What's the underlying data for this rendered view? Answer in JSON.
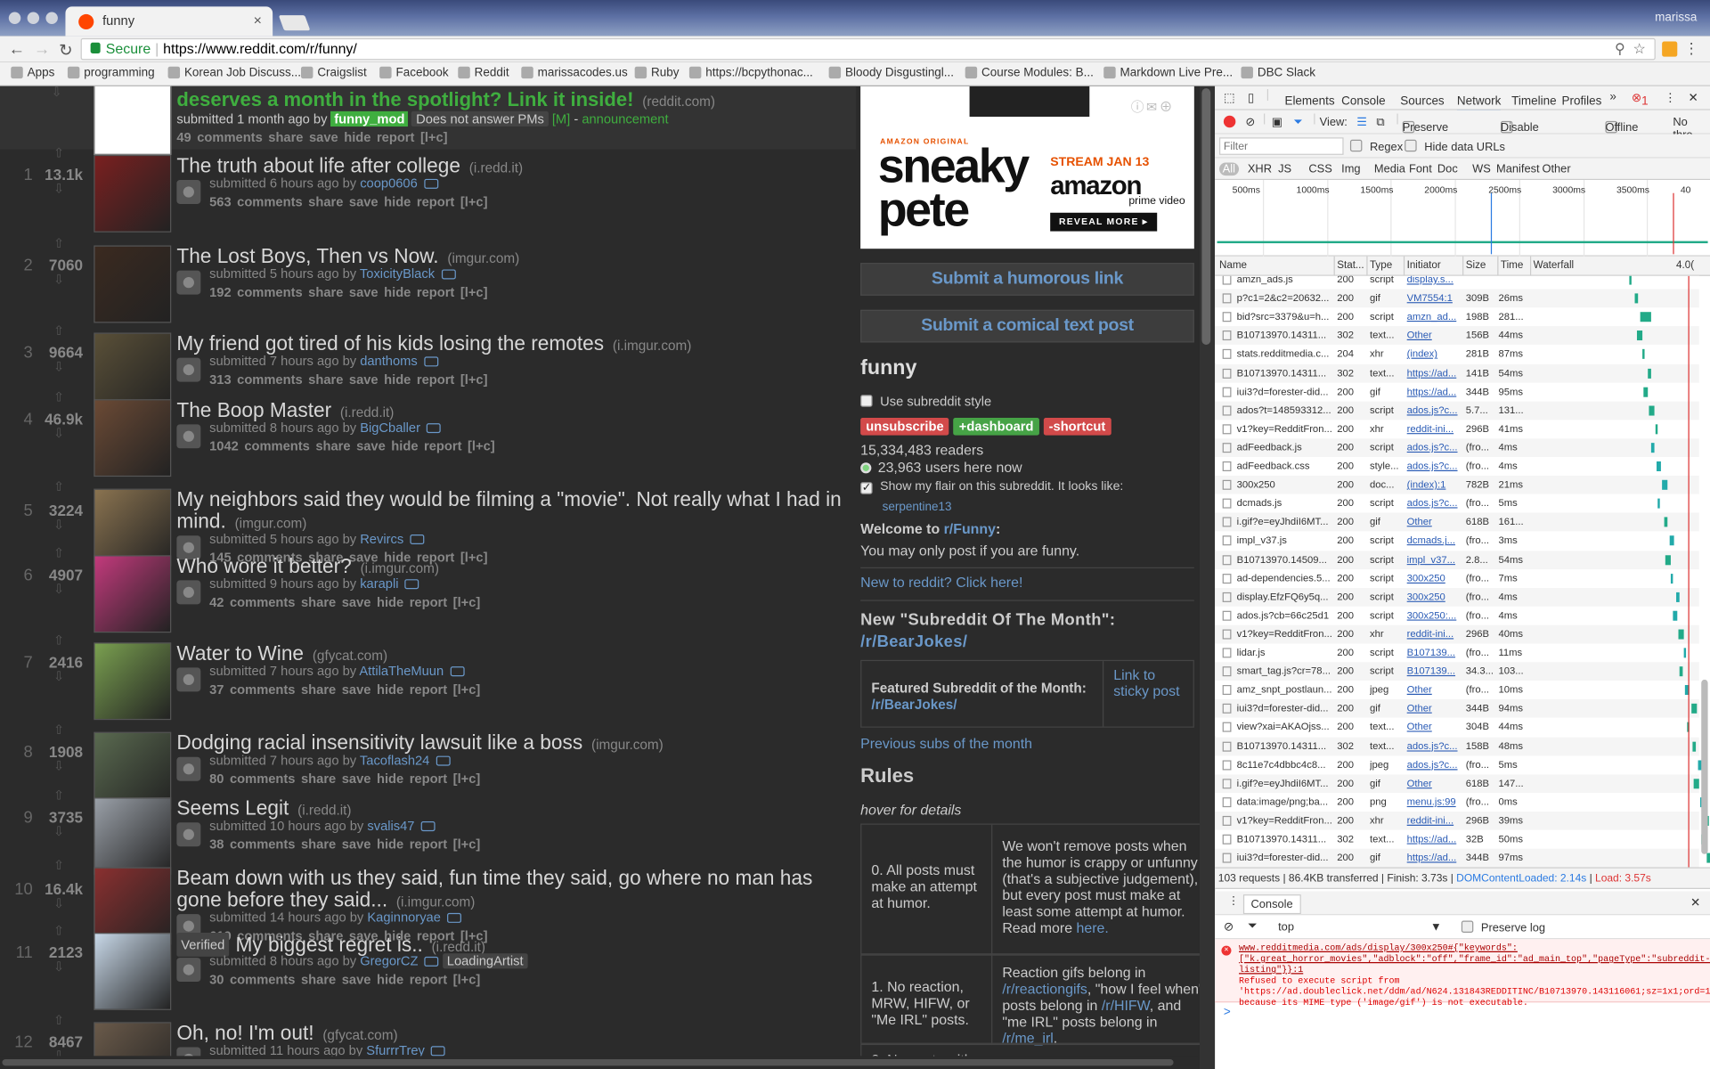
{
  "browser": {
    "tab_title": "funny",
    "url_secure": "Secure",
    "url": "https://www.reddit.com/r/funny/",
    "profile_name": "marissa",
    "bookmarks": [
      "Apps",
      "programming",
      "Korean Job Discuss...",
      "Craigslist",
      "Facebook",
      "Reddit",
      "marissacodes.us",
      "Ruby",
      "https://bcpythonac...",
      "Bloody Disgustingl...",
      "Course Modules: B...",
      "Markdown Live Pre...",
      "DBC Slack"
    ]
  },
  "sticky": {
    "title": "deserves a month in the spotlight? Link it inside!",
    "domain": "(reddit.com)",
    "submitted": "submitted 1 month ago by",
    "author": "funny_mod",
    "flair": "Does not answer PMs",
    "mod": "[M]",
    "dash": "-",
    "announcement": "announcement",
    "actions": "49 comments   share   save   hide   report   [l+c]"
  },
  "posts": [
    {
      "rank": "1",
      "score": "13.1k",
      "title": "The truth about life after college",
      "domain": "(i.redd.it)",
      "submitted": "submitted 6 hours ago by",
      "author": "coop0606",
      "actions": "563 comments   share   save   hide   report   [l+c]",
      "thumb": "#7a2020"
    },
    {
      "rank": "2",
      "score": "7060",
      "title": "The Lost Boys, Then vs Now.",
      "domain": "(imgur.com)",
      "submitted": "submitted 5 hours ago by",
      "author": "ToxicityBlack",
      "actions": "192 comments   share   save   hide   report   [l+c]",
      "thumb": "#3b2a20"
    },
    {
      "rank": "3",
      "score": "9664",
      "title": "My friend got tired of his kids losing the remotes",
      "domain": "(i.imgur.com)",
      "submitted": "submitted 7 hours ago by",
      "author": "danthoms",
      "actions": "313 comments   share   save   hide   report   [l+c]",
      "thumb": "#5a5038"
    },
    {
      "rank": "4",
      "score": "46.9k",
      "title": "The Boop Master",
      "domain": "(i.redd.it)",
      "submitted": "submitted 8 hours ago by",
      "author": "BigCballer",
      "actions": "1042 comments   share   save   hide   report   [l+c]",
      "thumb": "#6b4a35"
    },
    {
      "rank": "5",
      "score": "3224",
      "title": "My neighbors said they would be filming a \"movie\". Not really what I had in mind.",
      "domain": "(imgur.com)",
      "submitted": "submitted 5 hours ago by",
      "author": "Revircs",
      "actions": "145 comments   share   save   hide   report   [l+c]",
      "thumb": "#8a7350"
    },
    {
      "rank": "6",
      "score": "4907",
      "title": "Who wore it better?",
      "domain": "(i.imgur.com)",
      "submitted": "submitted 9 hours ago by",
      "author": "karapli",
      "actions": "42 comments   share   save   hide   report   [l+c]",
      "thumb": "#c23a7c"
    },
    {
      "rank": "7",
      "score": "2416",
      "title": "Water to Wine",
      "domain": "(gfycat.com)",
      "submitted": "submitted 7 hours ago by",
      "author": "AttilaTheMuun",
      "actions": "37 comments   share   save   hide   report   [l+c]",
      "thumb": "#7aa050"
    },
    {
      "rank": "8",
      "score": "1908",
      "title": "Dodging racial insensitivity lawsuit like a boss",
      "domain": "(imgur.com)",
      "submitted": "submitted 7 hours ago by",
      "author": "Tacoflash24",
      "actions": "80 comments   share   save   hide   report   [l+c]",
      "thumb": "#5a6a50"
    },
    {
      "rank": "9",
      "score": "3735",
      "title": "Seems Legit",
      "domain": "(i.redd.it)",
      "submitted": "submitted 10 hours ago by",
      "author": "svalis47",
      "actions": "38 comments   share   save   hide   report   [l+c]",
      "thumb": "#9aa0a8"
    },
    {
      "rank": "10",
      "score": "16.4k",
      "title": "Beam down with us they said, fun time they said, go where no man has gone before they said...",
      "domain": "(i.imgur.com)",
      "submitted": "submitted 14 hours ago by",
      "author": "Kaginnoryae",
      "actions": "619 comments   share   save   hide   report   [l+c]",
      "thumb": "#8a3030"
    },
    {
      "rank": "11",
      "score": "2123",
      "title": "My biggest regret is..",
      "domain": "(i.redd.it)",
      "submitted": "submitted 8 hours ago by",
      "author": "GregorCZ",
      "flair": "LoadingArtist",
      "verified": "Verified",
      "actions": "30 comments   share   save   hide   report   [l+c]",
      "thumb": "#c8d8e8"
    },
    {
      "rank": "12",
      "score": "8467",
      "title": "Oh, no! I'm out!",
      "domain": "(gfycat.com)",
      "submitted": "submitted 11 hours ago by",
      "author": "SfurrrTrey",
      "actions": "",
      "thumb": "#6a5a4a"
    }
  ],
  "sidebar": {
    "ad": {
      "label": "AMAZON ORIGINAL",
      "show1": "sneaky",
      "show2": "pete",
      "stream": "STREAM JAN 13",
      "brand": "amazon",
      "sub": "prime video",
      "cta": "REVEAL MORE ▸"
    },
    "submit_link": "Submit a humorous link",
    "submit_text": "Submit a comical text post",
    "name": "funny",
    "use_style": "Use subreddit style",
    "unsubscribe": "unsubscribe",
    "dashboard": "+dashboard",
    "shortcut": "-shortcut",
    "readers": "15,334,483 readers",
    "online": "23,963 users here now",
    "flair_text": "Show my flair on this subreddit. It looks like:",
    "flair_user": "serpentine13",
    "welcome1": "Welcome to ",
    "welcome_link": "r/Funny",
    "welcome2": ":",
    "only_funny": "You may only post if you are funny.",
    "new_to": "New to reddit? Click here!",
    "sotm1": "New \"Subreddit Of The Month\":",
    "sotm2": "/r/BearJokes/",
    "feat1": "Featured Subreddit of the Month:",
    "feat2": "/r/BearJokes/",
    "feat_link": "Link to sticky post",
    "prev": "Previous subs of the month",
    "rules": "Rules",
    "hover": "hover for details",
    "rule0": "0. All posts must make an attempt at humor.",
    "rule0_desc": "We won't remove posts when the humor is crappy or unfunny (that's a subjective judgement), but every post must make at least some attempt at humor. Read more",
    "rule0_here": "here.",
    "rule1": "1. No reaction, MRW, HIFW, or \"Me IRL\" posts.",
    "rule1_a": "Reaction gifs belong in",
    "rule1_b": "/r/reactiongifs",
    "rule1_c": ", \"how I feel when\" posts belong in",
    "rule1_d": "/r/HIFW",
    "rule1_e": ", and \"me IRL\" posts belong in",
    "rule1_f": "/r/me_irl",
    "rule1_g": ".",
    "rule2": "2. No posts with..."
  },
  "devtools": {
    "tabs": [
      "Elements",
      "Console",
      "Sources",
      "Network",
      "Timeline",
      "Profiles"
    ],
    "error_count": "1",
    "view": "View:",
    "preserve": "Preserve log",
    "disable": "Disable cache",
    "offline": "Offline",
    "nothrot": "No thro",
    "filter_ph": "Filter",
    "regex": "Regex",
    "hide_urls": "Hide data URLs",
    "types": [
      "All",
      "XHR",
      "JS",
      "CSS",
      "Img",
      "Media",
      "Font",
      "Doc",
      "WS",
      "Manifest",
      "Other"
    ],
    "ticks": [
      "500ms",
      "1000ms",
      "1500ms",
      "2000ms",
      "2500ms",
      "3000ms",
      "3500ms",
      "40"
    ],
    "cols": [
      "Name",
      "Stat...",
      "Type",
      "Initiator",
      "Size",
      "Time",
      "Waterfall",
      "4.0("
    ],
    "rows": [
      [
        "amzn_ads.js",
        "200",
        "script",
        "display.s...",
        "",
        "",
        "#2a8"
      ],
      [
        "p?c1=2&c2=20632...",
        "200",
        "gif",
        "VM7554:1",
        "309B",
        "26ms",
        "#2a8"
      ],
      [
        "bid?src=3379&u=h...",
        "200",
        "script",
        "amzn_ad...",
        "198B",
        "281...",
        "#2a8"
      ],
      [
        "B10713970.14311...",
        "302",
        "text...",
        "Other",
        "156B",
        "44ms",
        "#2a8"
      ],
      [
        "stats.redditmedia.c...",
        "204",
        "xhr",
        "(index)",
        "281B",
        "87ms",
        "#2a8"
      ],
      [
        "B10713970.14311...",
        "302",
        "text...",
        "https://ad...",
        "141B",
        "54ms",
        "#2a8"
      ],
      [
        "iui3?d=forester-did...",
        "200",
        "gif",
        "https://ad...",
        "344B",
        "95ms",
        "#2a8"
      ],
      [
        "ados?t=148593312...",
        "200",
        "script",
        "ados.js?c...",
        "5.7...",
        "131...",
        "#2a8"
      ],
      [
        "v1?key=RedditFron...",
        "200",
        "xhr",
        "reddit-ini...",
        "296B",
        "41ms",
        "#2a8"
      ],
      [
        "adFeedback.js",
        "200",
        "script",
        "ados.js?c...",
        "(fro...",
        "4ms",
        "#2aa"
      ],
      [
        "adFeedback.css",
        "200",
        "style...",
        "ados.js?c...",
        "(fro...",
        "4ms",
        "#2aa"
      ],
      [
        "300x250",
        "200",
        "doc...",
        "(index):1",
        "782B",
        "21ms",
        "#2aa"
      ],
      [
        "dcmads.js",
        "200",
        "script",
        "ados.js?c...",
        "(fro...",
        "5ms",
        "#2aa"
      ],
      [
        "i.gif?e=eyJhdiI6MT...",
        "200",
        "gif",
        "Other",
        "618B",
        "161...",
        "#2a8"
      ],
      [
        "impl_v37.js",
        "200",
        "script",
        "dcmads.j...",
        "(fro...",
        "3ms",
        "#2aa"
      ],
      [
        "B10713970.14509...",
        "200",
        "script",
        "impl_v37...",
        "2.8...",
        "54ms",
        "#2a8"
      ],
      [
        "ad-dependencies.5...",
        "200",
        "script",
        "300x250",
        "(fro...",
        "7ms",
        "#2aa"
      ],
      [
        "display.EfzFQ6y5q...",
        "200",
        "script",
        "300x250",
        "(fro...",
        "4ms",
        "#2aa"
      ],
      [
        "ados.js?cb=66c25d1",
        "200",
        "script",
        "300x250:...",
        "(fro...",
        "4ms",
        "#2aa"
      ],
      [
        "v1?key=RedditFron...",
        "200",
        "xhr",
        "reddit-ini...",
        "296B",
        "40ms",
        "#2a8"
      ],
      [
        "lidar.js",
        "200",
        "script",
        "B107139...",
        "(fro...",
        "11ms",
        "#2aa"
      ],
      [
        "smart_tag.js?cr=78...",
        "200",
        "script",
        "B107139...",
        "34.3...",
        "103...",
        "#2a8"
      ],
      [
        "amz_snpt_postlaun...",
        "200",
        "jpeg",
        "Other",
        "(fro...",
        "10ms",
        "#2aa"
      ],
      [
        "iui3?d=forester-did...",
        "200",
        "gif",
        "Other",
        "344B",
        "94ms",
        "#2a8"
      ],
      [
        "view?xai=AKAOjss...",
        "200",
        "text...",
        "Other",
        "304B",
        "44ms",
        "#2a8"
      ],
      [
        "B10713970.14311...",
        "302",
        "text...",
        "ados.js?c...",
        "158B",
        "48ms",
        "#2a8"
      ],
      [
        "8c11e7c4dbbc4c8...",
        "200",
        "jpeg",
        "ados.js?c...",
        "(fro...",
        "5ms",
        "#2aa"
      ],
      [
        "i.gif?e=eyJhdiI6MT...",
        "200",
        "gif",
        "Other",
        "618B",
        "147...",
        "#2a8"
      ],
      [
        "data:image/png;ba...",
        "200",
        "png",
        "menu.js:99",
        "(fro...",
        "0ms",
        "#2aa"
      ],
      [
        "v1?key=RedditFron...",
        "200",
        "xhr",
        "reddit-ini...",
        "296B",
        "39ms",
        "#2a8"
      ],
      [
        "B10713970.14311...",
        "302",
        "text...",
        "https://ad...",
        "32B",
        "50ms",
        "#2a8"
      ],
      [
        "iui3?d=forester-did...",
        "200",
        "gif",
        "https://ad...",
        "344B",
        "97ms",
        "#2a8"
      ]
    ],
    "summary": "103 requests | 86.4KB transferred | Finish: 3.73s | ",
    "dcl": "DOMContentLoaded: 2.14s",
    "sep": " | ",
    "load": "Load: 3.57s",
    "console_tab": "Console",
    "context": "top",
    "preserve2": "Preserve log",
    "err_url": "www.redditmedia.com/ads/display/300x250#{\"keywords\":[\"k.great_horror_movies\",\"adblock\":\"off\",\"frame_id\":\"ad_main_top\",\"pageType\":\"subreddit-listing\"}}:1",
    "err_text": "Refused to execute script from 'https://ad.doubleclick.net/ddm/ad/N624.131843REDDITINC/B10713970.143116061;sz=1x1;ord=1485933120525?' because its MIME type ('image/gif') is not executable.",
    "prompt": ">"
  }
}
